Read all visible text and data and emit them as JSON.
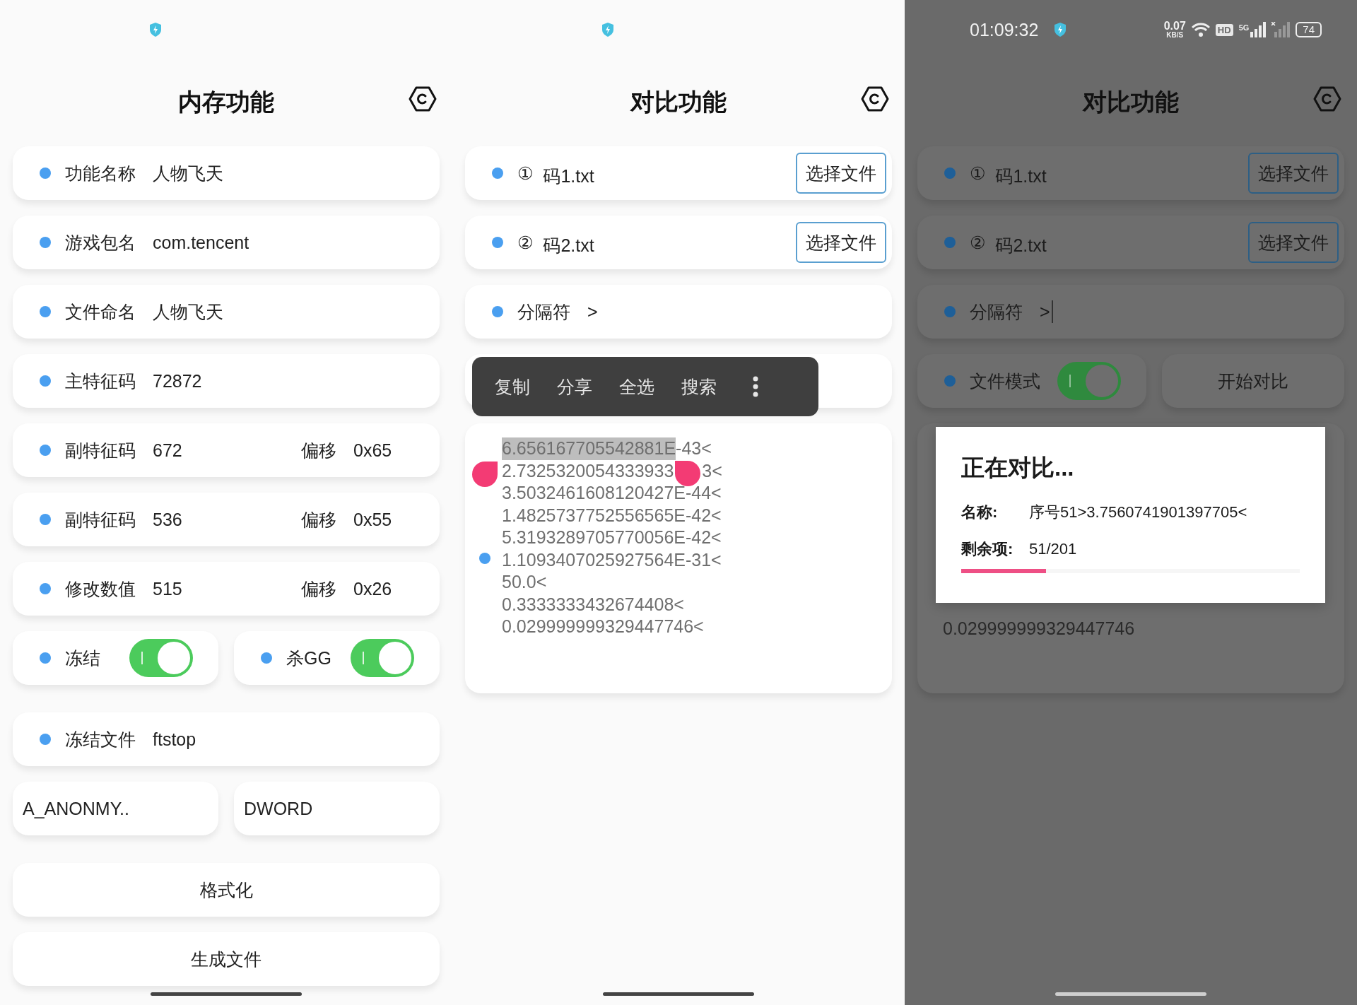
{
  "panels": [
    {
      "dimmed": false,
      "title": "内存功能",
      "rows": [
        {
          "kind": "field",
          "label": "功能名称",
          "value": "人物飞天"
        },
        {
          "kind": "field",
          "label": "游戏包名",
          "value": "com.tencent"
        },
        {
          "kind": "field",
          "label": "文件命名",
          "value": "人物飞天"
        },
        {
          "kind": "field",
          "label": "主特征码",
          "value": "72872"
        },
        {
          "kind": "field",
          "label": "副特征码",
          "value": "672",
          "offset_label": "偏移",
          "offset_value": "0x65"
        },
        {
          "kind": "field",
          "label": "副特征码",
          "value": "536",
          "offset_label": "偏移",
          "offset_value": "0x55"
        },
        {
          "kind": "field",
          "label": "修改数值",
          "value": "515",
          "offset_label": "偏移",
          "offset_value": "0x26"
        },
        {
          "kind": "toggle_pair",
          "items": [
            {
              "label": "冻结",
              "on": true
            },
            {
              "label": "杀GG",
              "on": true
            }
          ]
        },
        {
          "kind": "field",
          "label": "冻结文件",
          "value": "ftstop"
        },
        {
          "kind": "select_pair",
          "items": [
            {
              "value": "A_ANONMY.."
            },
            {
              "value": "DWORD"
            }
          ]
        },
        {
          "kind": "button",
          "label": "格式化"
        },
        {
          "kind": "button",
          "label": "生成文件"
        }
      ]
    },
    {
      "dimmed": false,
      "title": "对比功能",
      "rows": [
        {
          "kind": "file",
          "index": "①",
          "name": "码1.txt",
          "button": "选择文件"
        },
        {
          "kind": "file",
          "index": "②",
          "name": "码2.txt",
          "button": "选择文件"
        },
        {
          "kind": "field",
          "label": "分隔符",
          "value": ">",
          "cursor": false
        },
        {
          "kind": "menu_overlay",
          "menu": [
            "复制",
            "分享",
            "全选",
            "搜索"
          ]
        },
        {
          "kind": "output",
          "lines": [
            {
              "segments": [
                {
                  "text": "6.656167705542881E",
                  "selected": true
                },
                {
                  "text": "-43<",
                  "selected": false
                }
              ]
            },
            {
              "segments": [
                {
                  "text": "2.7325320054333933",
                  "selected": false,
                  "handle_before": true
                },
                {
                  "text": "3<",
                  "selected": false,
                  "handle_before": true
                }
              ]
            },
            {
              "segments": [
                {
                  "text": "3.5032461608120427E-44<",
                  "selected": false
                }
              ]
            },
            {
              "segments": [
                {
                  "text": "1.4825737752556565E-42<",
                  "selected": false
                }
              ]
            },
            {
              "segments": [
                {
                  "text": "5.3193289705770056E-42<",
                  "selected": false
                }
              ]
            },
            {
              "segments": [
                {
                  "text": "1.1093407025927564E-31<",
                  "selected": false
                }
              ]
            },
            {
              "segments": [
                {
                  "text": "50.0<",
                  "selected": false
                }
              ]
            },
            {
              "segments": [
                {
                  "text": "0.3333333432674408<",
                  "selected": false
                }
              ]
            },
            {
              "segments": [
                {
                  "text": "0.029999999329447746<",
                  "selected": false
                }
              ]
            }
          ]
        }
      ]
    },
    {
      "dimmed": true,
      "status_bar": {
        "time": "01:09:32",
        "net_speed": "0.07",
        "net_unit": "KB/S",
        "hd_label": "HD",
        "network_label": "5G",
        "battery": "74"
      },
      "title": "对比功能",
      "rows": [
        {
          "kind": "file",
          "index": "①",
          "name": "码1.txt",
          "button": "选择文件"
        },
        {
          "kind": "file",
          "index": "②",
          "name": "码2.txt",
          "button": "选择文件"
        },
        {
          "kind": "field",
          "label": "分隔符",
          "value": ">",
          "cursor": true
        },
        {
          "kind": "mode_row",
          "label": "文件模式",
          "on": true,
          "button": "开始对比"
        },
        {
          "kind": "output",
          "lines": [
            {
              "segments": [
                {
                  "text": "0.029999999329447746",
                  "selected": false
                }
              ]
            }
          ]
        }
      ],
      "dialog": {
        "title": "正在对比...",
        "fields": [
          {
            "label": "名称:",
            "value": "序号51>3.7560741901397705<"
          },
          {
            "label": "剩余项:",
            "value": "51/201"
          }
        ],
        "progress": {
          "level": 0.25
        }
      }
    }
  ]
}
